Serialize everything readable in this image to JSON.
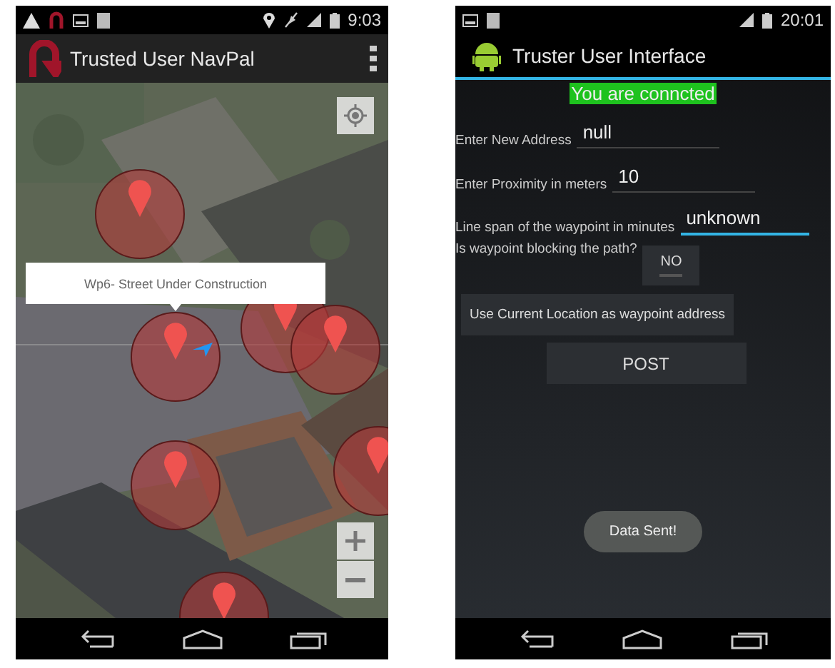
{
  "map_app": {
    "status_bar": {
      "time": "9:03"
    },
    "title": "Trusted User NavPal",
    "info_window": "Wp6- Street Under Construction"
  },
  "form_app": {
    "status_bar": {
      "time": "20:01"
    },
    "title": "Truster User Interface",
    "banner": "You are conncted",
    "fields": [
      {
        "label": "Enter New Address",
        "value": "null",
        "focused": false
      },
      {
        "label": "Enter Proximity in meters",
        "value": "10",
        "focused": false
      },
      {
        "label": "Line span of the waypoint in minutes",
        "value": "unknown",
        "focused": true
      }
    ],
    "blocking": {
      "label": "Is waypoint blocking the path?",
      "toggle": "NO",
      "on": false
    },
    "buttons": [
      "Use Current Location as waypoint address",
      "POST"
    ],
    "toast": "Data Sent!"
  }
}
